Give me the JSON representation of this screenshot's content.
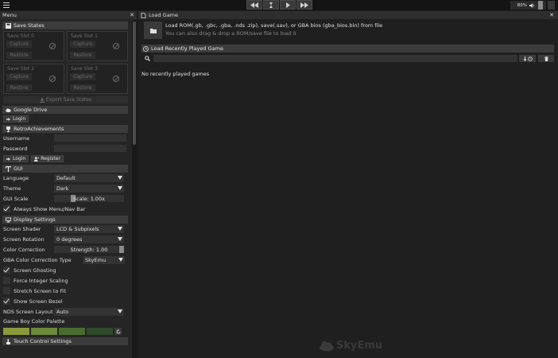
{
  "topbar": {
    "volume": "80%"
  },
  "menu": {
    "title": "Menu",
    "save_states": {
      "header": "Save States",
      "slots": [
        {
          "name": "Save Slot 0",
          "capture": "Capture",
          "restore": "Restore"
        },
        {
          "name": "Save Slot 1",
          "capture": "Capture",
          "restore": "Restore"
        },
        {
          "name": "Save Slot 2",
          "capture": "Capture",
          "restore": "Restore"
        },
        {
          "name": "Save Slot 3",
          "capture": "Capture",
          "restore": "Restore"
        }
      ],
      "export": "Export Save States"
    },
    "google_drive": {
      "header": "Google Drive",
      "login": "Login"
    },
    "retro": {
      "header": "RetroAchievements",
      "username_label": "Username",
      "password_label": "Password",
      "login": "Login",
      "register": "Register"
    },
    "gui": {
      "header": "GUI",
      "language_label": "Language",
      "language_value": "Default",
      "theme_label": "Theme",
      "theme_value": "Dark",
      "scale_label": "GUI Scale",
      "scale_value": "Scale: 1.00x",
      "scale_level": 0.25,
      "always_show_menu": "Always Show Menu/Nav Bar"
    },
    "display": {
      "header": "Display Settings",
      "shader_label": "Screen Shader",
      "shader_value": "LCD & Subpixels",
      "rotation_label": "Screen Rotation",
      "rotation_value": "0 degrees",
      "color_corr_label": "Color Correction",
      "color_corr_value": "Strength: 1.00",
      "color_corr_level": 1.0,
      "gba_type_label": "GBA Color Correction Type",
      "gba_type_value": "SkyEmu",
      "ghosting": "Screen Ghosting",
      "integer_scaling": "Force Integer Scaling",
      "stretch": "Stretch Screen to Fit",
      "bezel": "Show Screen Bezel",
      "nds_layout_label": "NDS Screen Layout",
      "nds_layout_value": "Auto",
      "gb_palette_label": "Game Boy Color Palette",
      "palette": [
        "#8a9a3a",
        "#6b8a3a",
        "#4a6b30",
        "#2f4a2a"
      ]
    },
    "touch": {
      "header": "Touch Control Settings"
    }
  },
  "load": {
    "title": "Load Game",
    "instruction": "Load ROM(.gb, .gbc, .gba, .nds .zip), save(.sav), or GBA bios (gba_bios.bin) from file",
    "drag_hint": "You can also drag & drop a ROM/save file to load it",
    "recent_header": "Load Recently Played Game",
    "empty": "No recently played games",
    "watermark": "SkyEmu"
  }
}
